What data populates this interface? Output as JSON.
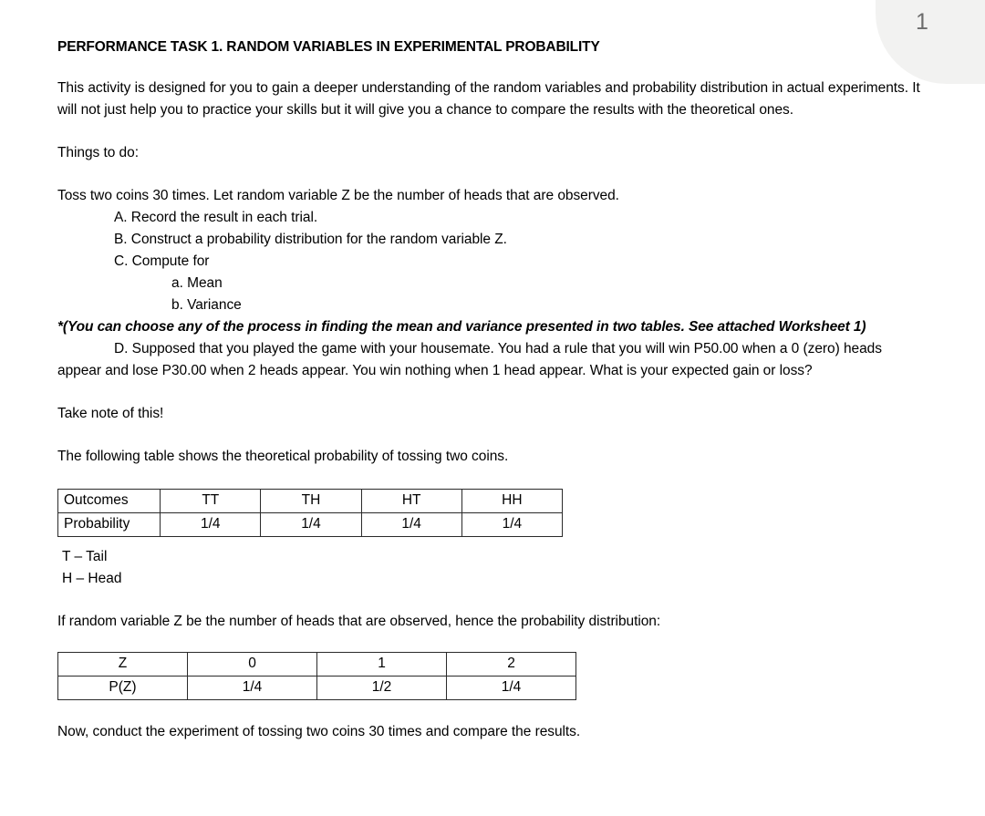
{
  "page": {
    "number": "1"
  },
  "document": {
    "title": "PERFORMANCE TASK 1. RANDOM VARIABLES IN EXPERIMENTAL PROBABILITY",
    "intro": "This activity is designed for you to gain a deeper understanding of the random variables and probability distribution in actual experiments. It will not just help you to practice your skills but it will give you a chance to compare the results with the theoretical ones.",
    "things_to_do_label": "Things to do:",
    "instruction": "Toss two coins 30 times. Let random variable Z be the number of heads that are observed.",
    "steps": [
      "A. Record the result in each trial.",
      "B. Construct a probability distribution for the random variable Z.",
      "C. Compute for"
    ],
    "substeps": [
      "a. Mean",
      "b. Variance"
    ],
    "note": "*(You can choose any of the process in finding the mean and variance presented in two tables. See attached Worksheet 1)",
    "step_d": "D.  Supposed that you played the game with your housemate. You had a rule that you will win P50.00 when a 0 (zero) heads appear and lose P30.00 when 2 heads appear. You win nothing when 1 head appear. What is your expected gain or loss?",
    "take_note": "Take note of this!",
    "table1_intro": "The following table shows the theoretical probability of tossing two coins.",
    "table2_intro": "If random variable Z be the number of heads that are observed, hence the probability distribution:",
    "closing": "Now, conduct the experiment of tossing two coins 30 times and compare the results."
  },
  "table_outcomes": {
    "row_labels": [
      "Outcomes",
      "Probability"
    ],
    "outcomes": [
      "TT",
      "TH",
      "HT",
      "HH"
    ],
    "probabilities": [
      "1/4",
      "1/4",
      "1/4",
      "1/4"
    ]
  },
  "legend": {
    "tail": "T – Tail",
    "head": "H – Head"
  },
  "table_z": {
    "row_labels": [
      "Z",
      "P(Z)"
    ],
    "z_values": [
      "0",
      "1",
      "2"
    ],
    "pz_values": [
      "1/4",
      "1/2",
      "1/4"
    ]
  }
}
